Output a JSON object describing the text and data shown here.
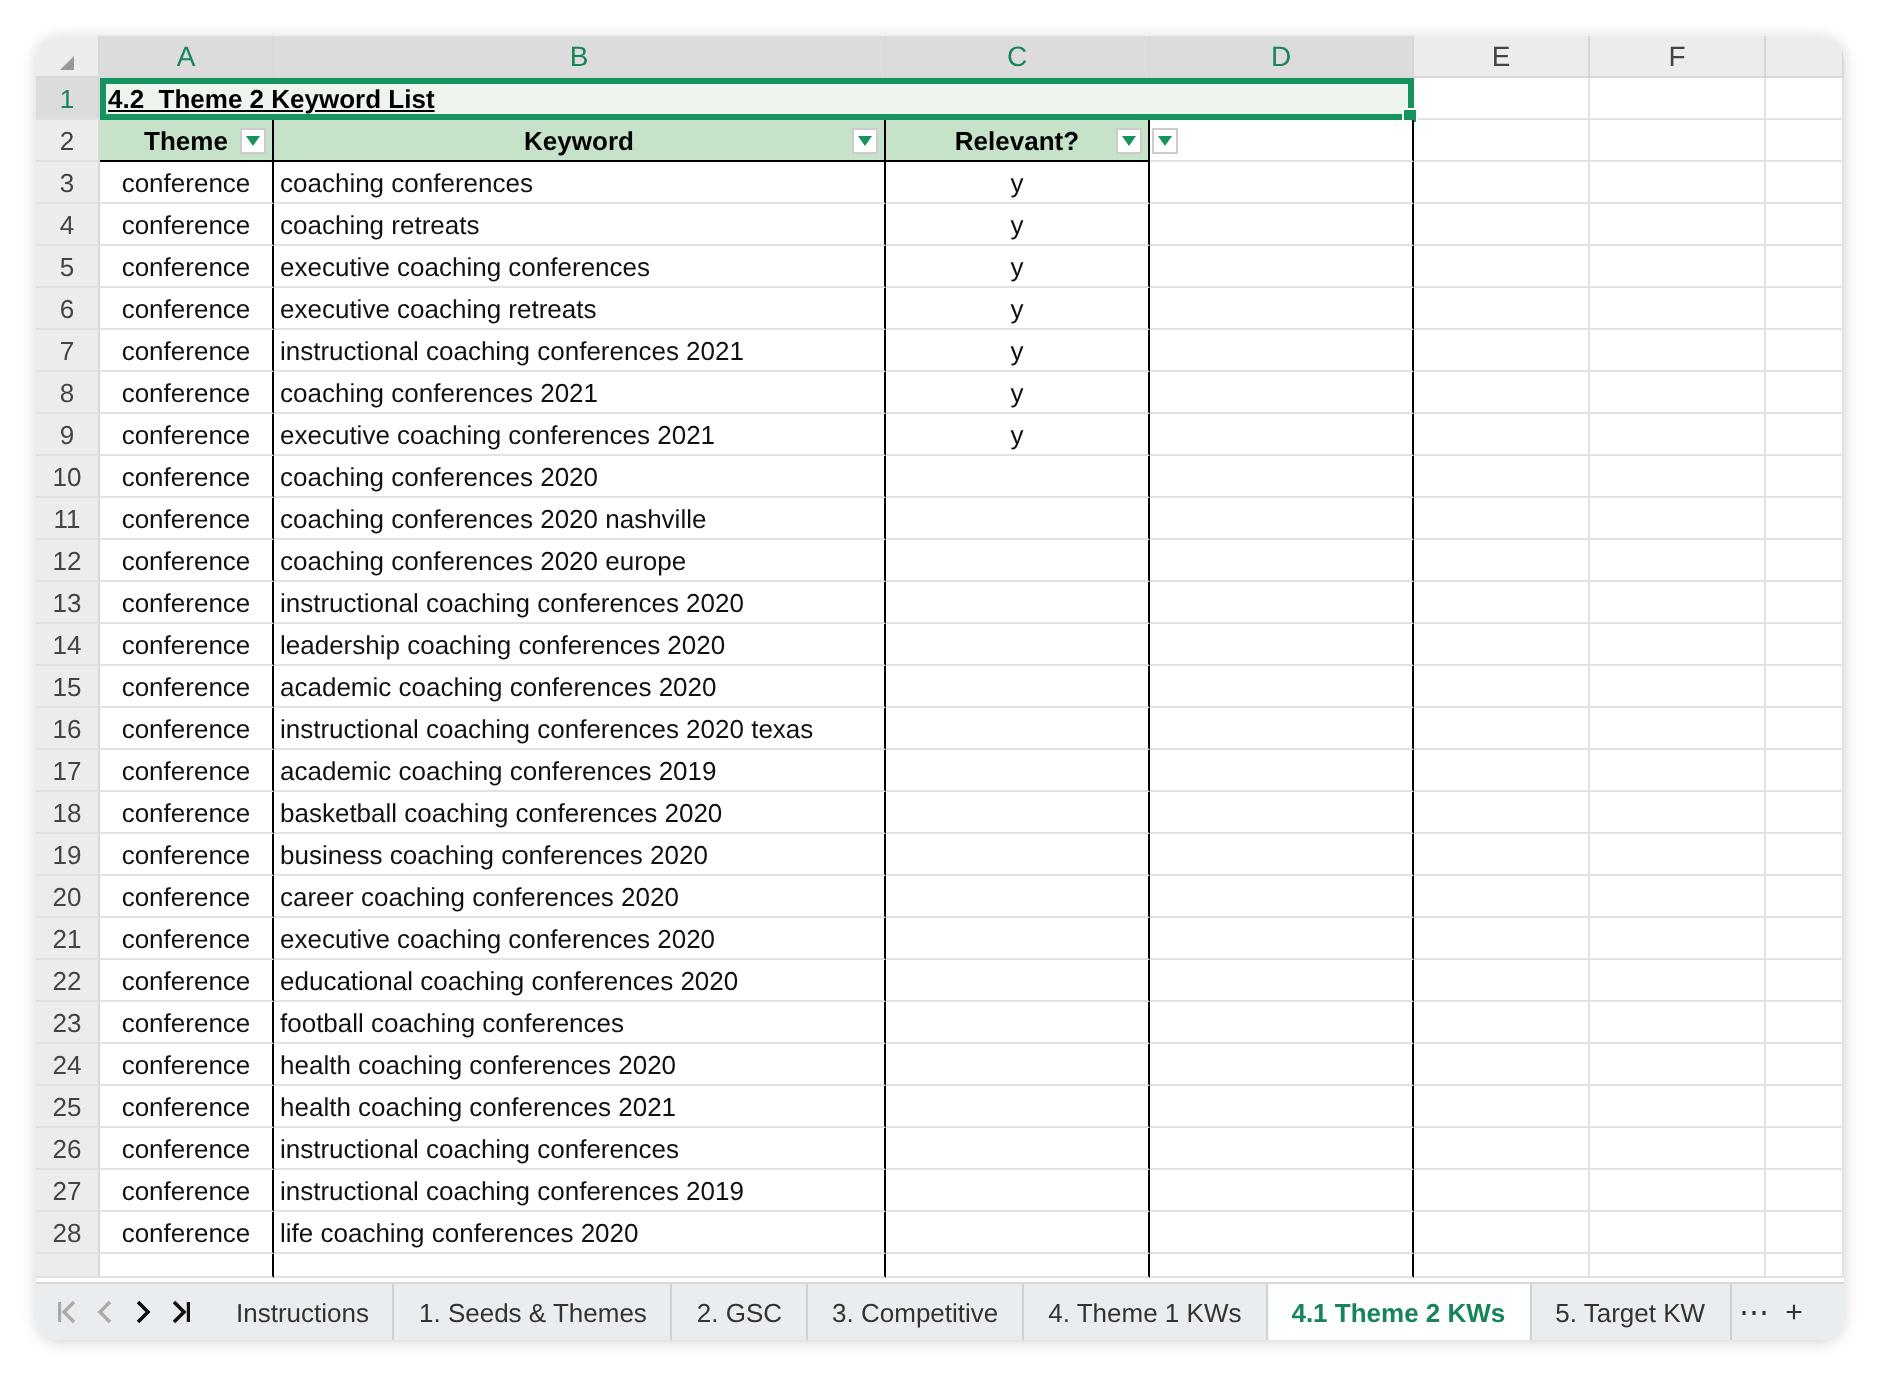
{
  "columns": [
    {
      "label": "A",
      "selected": true
    },
    {
      "label": "B",
      "selected": true
    },
    {
      "label": "C",
      "selected": true
    },
    {
      "label": "D",
      "selected": true
    },
    {
      "label": "E",
      "selected": false
    },
    {
      "label": "F",
      "selected": false
    }
  ],
  "title_row": {
    "row_number": "1",
    "text": "4.2  Theme 2 Keyword List",
    "selected": true
  },
  "header_row": {
    "row_number": "2",
    "headers": [
      "Theme",
      "Keyword",
      "Relevant?"
    ]
  },
  "rows": [
    {
      "row_number": "3",
      "theme": "conference",
      "keyword": "coaching conferences",
      "relevant": "y"
    },
    {
      "row_number": "4",
      "theme": "conference",
      "keyword": "coaching retreats",
      "relevant": "y"
    },
    {
      "row_number": "5",
      "theme": "conference",
      "keyword": "executive coaching conferences",
      "relevant": "y"
    },
    {
      "row_number": "6",
      "theme": "conference",
      "keyword": "executive coaching retreats",
      "relevant": "y"
    },
    {
      "row_number": "7",
      "theme": "conference",
      "keyword": "instructional coaching conferences 2021",
      "relevant": "y"
    },
    {
      "row_number": "8",
      "theme": "conference",
      "keyword": "coaching conferences 2021",
      "relevant": "y"
    },
    {
      "row_number": "9",
      "theme": "conference",
      "keyword": "executive coaching conferences 2021",
      "relevant": "y"
    },
    {
      "row_number": "10",
      "theme": "conference",
      "keyword": "coaching conferences 2020"
    },
    {
      "row_number": "11",
      "theme": "conference",
      "keyword": "coaching conferences 2020 nashville"
    },
    {
      "row_number": "12",
      "theme": "conference",
      "keyword": "coaching conferences 2020 europe"
    },
    {
      "row_number": "13",
      "theme": "conference",
      "keyword": "instructional coaching conferences 2020"
    },
    {
      "row_number": "14",
      "theme": "conference",
      "keyword": "leadership coaching conferences 2020"
    },
    {
      "row_number": "15",
      "theme": "conference",
      "keyword": "academic coaching conferences 2020"
    },
    {
      "row_number": "16",
      "theme": "conference",
      "keyword": "instructional coaching conferences 2020 texas"
    },
    {
      "row_number": "17",
      "theme": "conference",
      "keyword": "academic coaching conferences 2019"
    },
    {
      "row_number": "18",
      "theme": "conference",
      "keyword": "basketball coaching conferences 2020"
    },
    {
      "row_number": "19",
      "theme": "conference",
      "keyword": "business coaching conferences 2020"
    },
    {
      "row_number": "20",
      "theme": "conference",
      "keyword": "career coaching conferences 2020"
    },
    {
      "row_number": "21",
      "theme": "conference",
      "keyword": "executive coaching conferences 2020"
    },
    {
      "row_number": "22",
      "theme": "conference",
      "keyword": "educational coaching conferences 2020"
    },
    {
      "row_number": "23",
      "theme": "conference",
      "keyword": "football coaching conferences"
    },
    {
      "row_number": "24",
      "theme": "conference",
      "keyword": "health coaching conferences 2020"
    },
    {
      "row_number": "25",
      "theme": "conference",
      "keyword": "health coaching conferences 2021"
    },
    {
      "row_number": "26",
      "theme": "conference",
      "keyword": "instructional coaching conferences"
    },
    {
      "row_number": "27",
      "theme": "conference",
      "keyword": "instructional coaching conferences 2019"
    },
    {
      "row_number": "28",
      "theme": "conference",
      "keyword": "life coaching conferences 2020"
    }
  ],
  "sheet_tabs": [
    {
      "label": "Instructions",
      "selected": false
    },
    {
      "label": "1. Seeds & Themes",
      "selected": false
    },
    {
      "label": "2. GSC",
      "selected": false
    },
    {
      "label": "3. Competitive",
      "selected": false
    },
    {
      "label": "4. Theme 1 KWs",
      "selected": false
    },
    {
      "label": "4.1 Theme 2 KWs",
      "selected": true
    },
    {
      "label": "5. Target KW",
      "selected": false
    }
  ],
  "more_tabs": "⋯",
  "add_tab": "+"
}
